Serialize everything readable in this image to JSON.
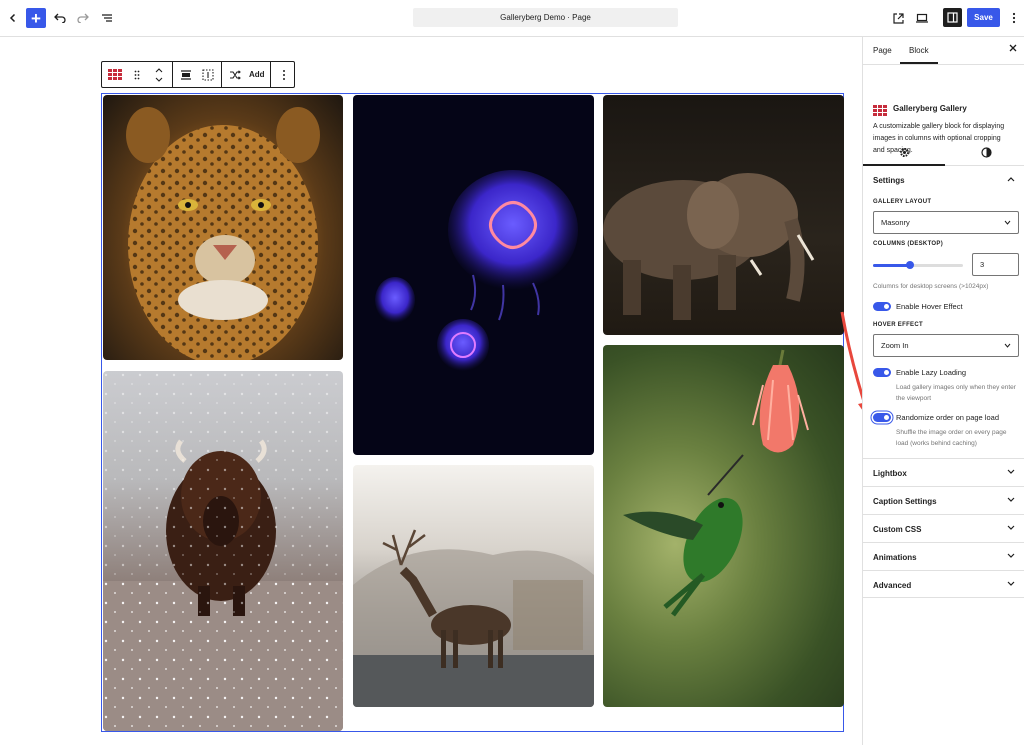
{
  "header": {
    "title": "Galleryberg Demo · Page",
    "save_label": "Save"
  },
  "block_toolbar": {
    "add_label": "Add"
  },
  "sidebar": {
    "tabs": [
      "Page",
      "Block"
    ],
    "block_name": "Galleryberg Gallery",
    "block_description": "A customizable gallery block for displaying images in columns with optional cropping and spacing.",
    "settings": {
      "title": "Settings",
      "gallery_layout_label": "GALLERY LAYOUT",
      "gallery_layout_value": "Masonry",
      "columns_label": "COLUMNS (DESKTOP)",
      "columns_value": "3",
      "columns_slider_fraction": 0.4,
      "columns_help": "Columns for desktop screens (>1024px)",
      "hover_toggle_label": "Enable Hover Effect",
      "hover_effect_label": "HOVER EFFECT",
      "hover_effect_value": "Zoom In",
      "lazy_toggle_label": "Enable Lazy Loading",
      "lazy_help": "Load gallery images only when they enter the viewport",
      "randomize_toggle_label": "Randomize order on page load",
      "randomize_help": "Shuffle the image order on every page load (works behind caching)"
    },
    "panels": [
      "Lightbox",
      "Caption Settings",
      "Custom CSS",
      "Animations",
      "Advanced"
    ]
  },
  "icons": {
    "back": "chevron-left-icon",
    "inserter": "plus-icon",
    "undo": "undo-icon",
    "redo": "redo-icon",
    "list_view": "list-view-icon",
    "view_external": "external-link-icon",
    "preview": "desktop-preview-icon",
    "settings_toggle": "sidebar-toggle-icon",
    "more": "kebab-menu-icon"
  },
  "colors": {
    "accent": "#3858e9",
    "brand_block_icon": "#c62c3c",
    "annotation_arrow": "#e8473c"
  },
  "gallery": {
    "images": [
      "leopard",
      "jellyfish",
      "elephants",
      "bison",
      "stag",
      "hummingbird"
    ]
  }
}
